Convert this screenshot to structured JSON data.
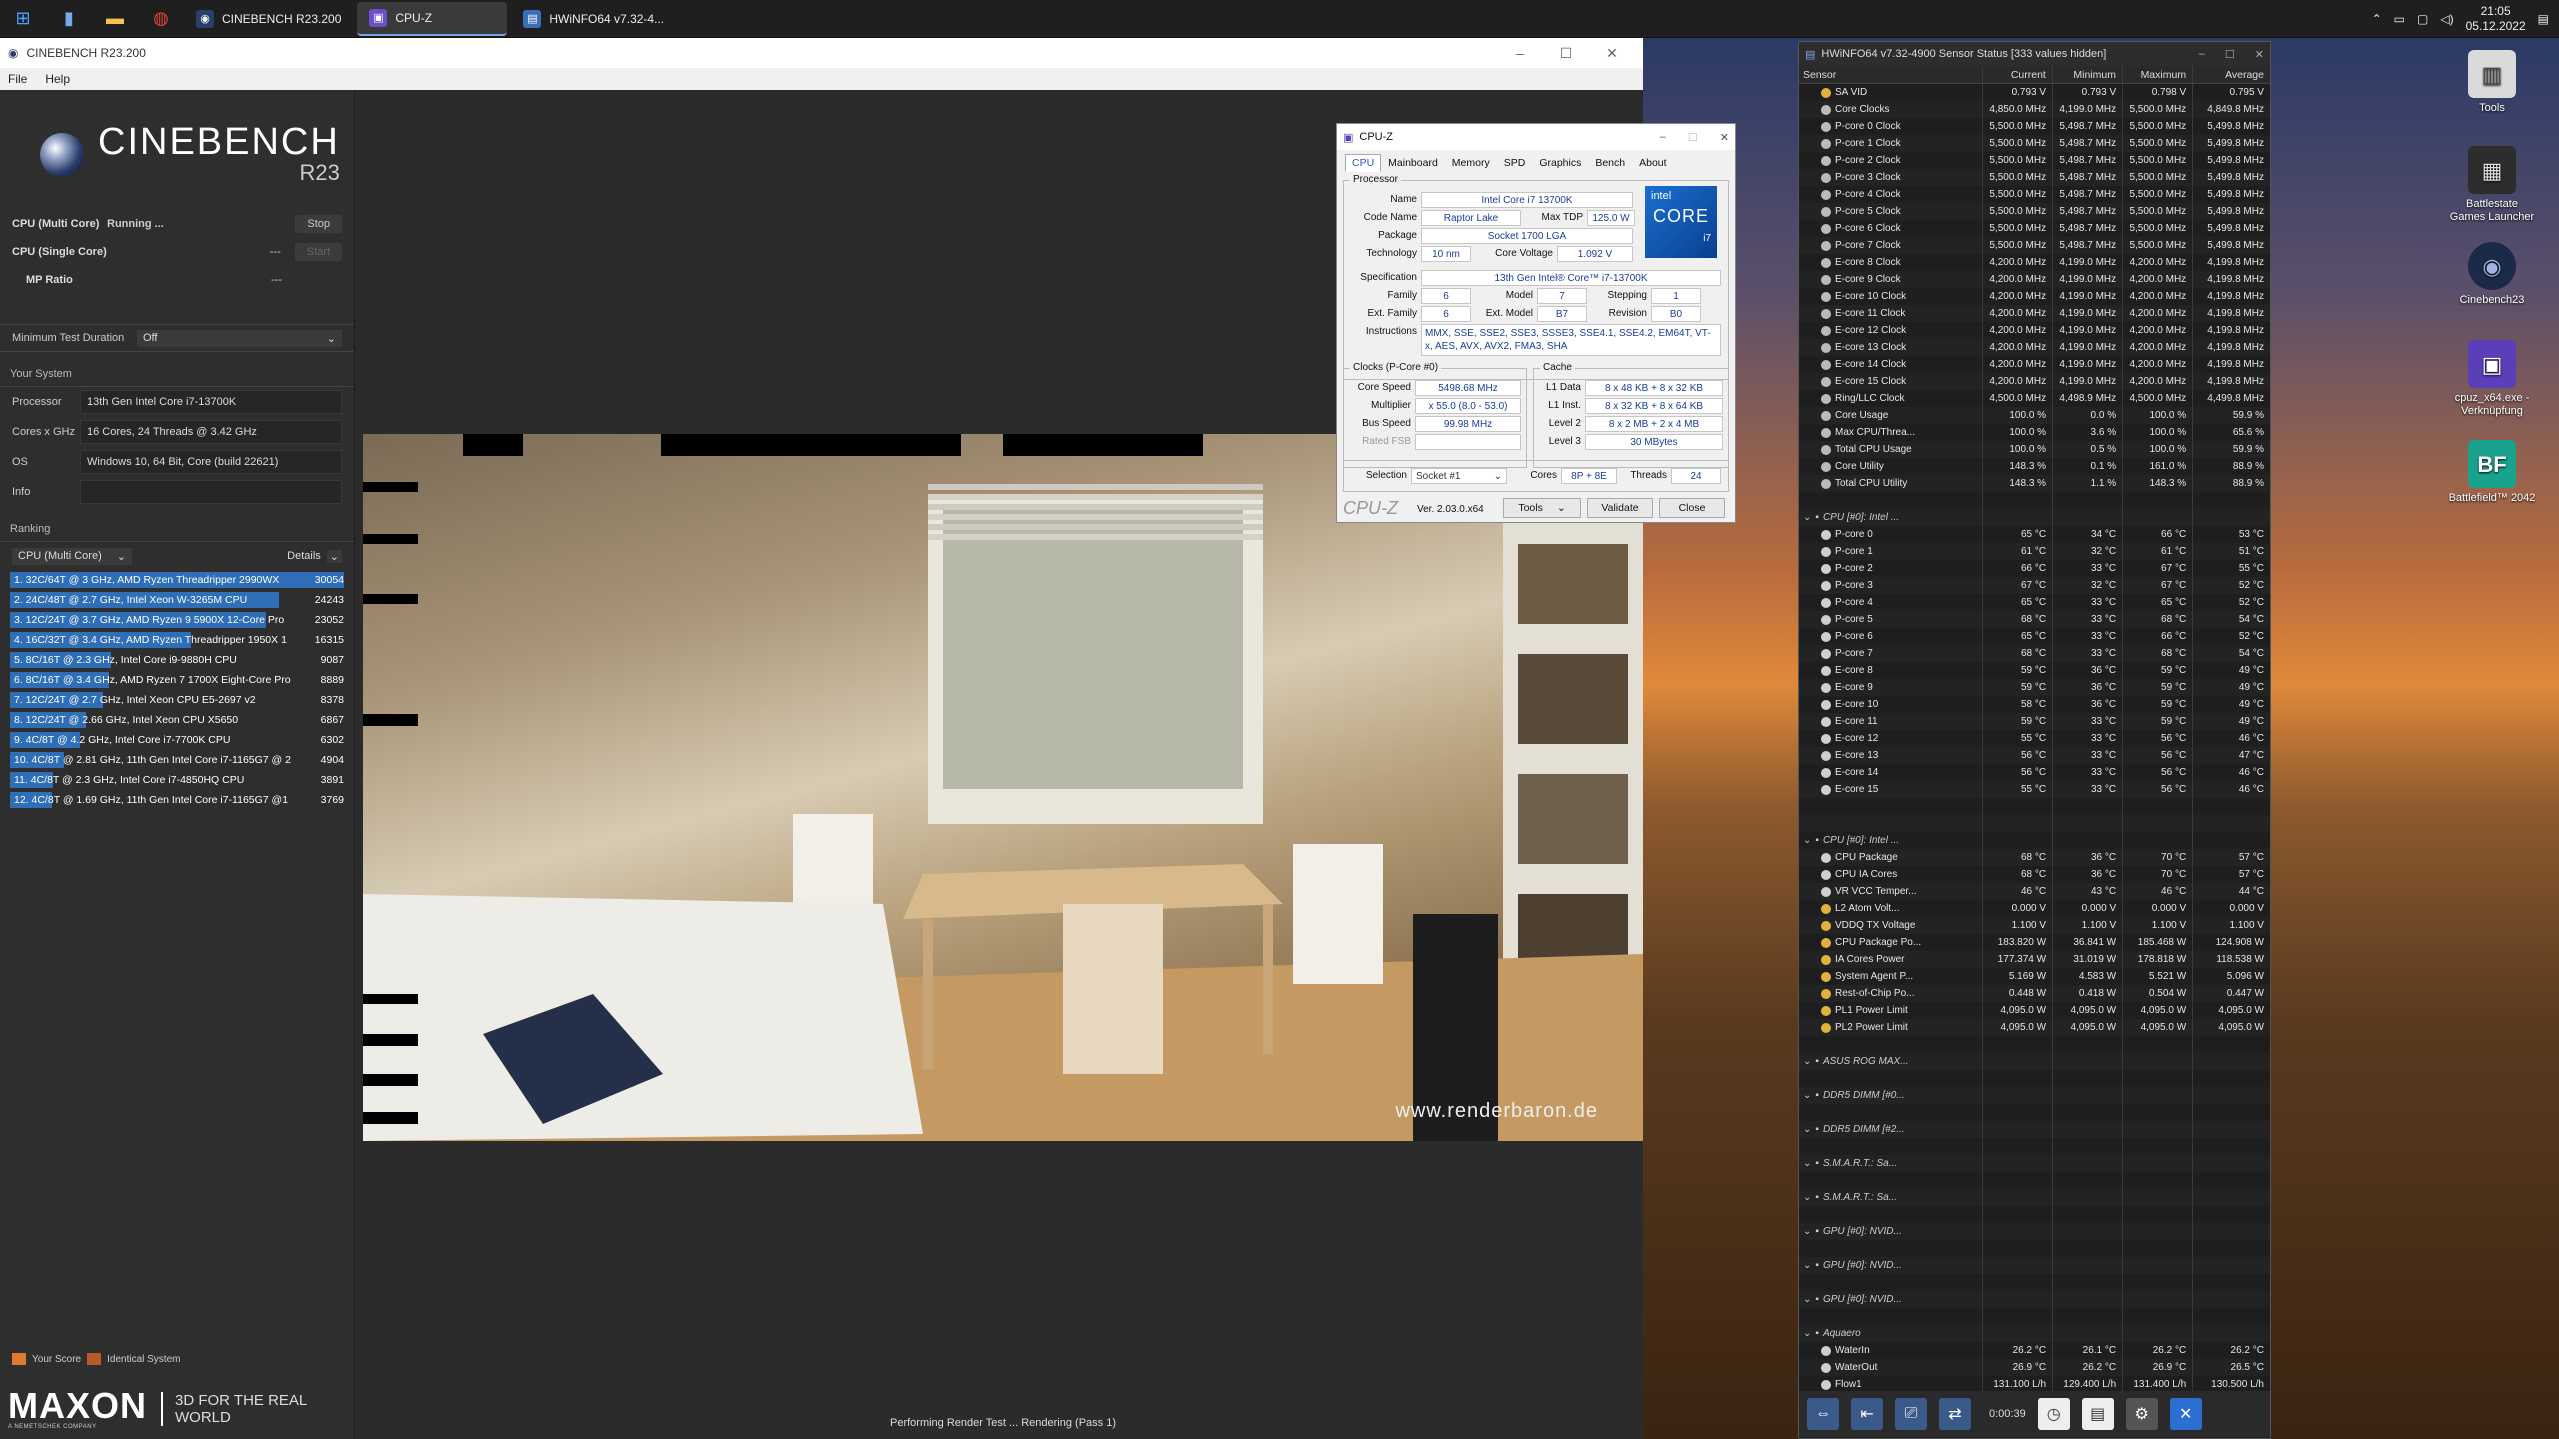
{
  "taskbar": {
    "apps": [
      {
        "label": "CINEBENCH R23.200",
        "icon": "cinebench-icon",
        "active": false
      },
      {
        "label": "CPU-Z",
        "icon": "cpuz-icon",
        "active": true
      },
      {
        "label": "HWiNFO64 v7.32-4...",
        "icon": "hwinfo-icon",
        "active": false
      }
    ],
    "time": "21:05",
    "date": "05.12.2022"
  },
  "cinebench": {
    "title": "CINEBENCH R23.200",
    "menu": [
      "File",
      "Help"
    ],
    "logo": "CINEBENCH",
    "version": "R23",
    "tests": [
      {
        "label": "CPU (Multi Core)",
        "status": "Running ...",
        "button": "Stop",
        "button_enabled": true
      },
      {
        "label": "CPU (Single Core)",
        "status": "---",
        "button": "Start",
        "button_enabled": false
      },
      {
        "label": "MP Ratio",
        "status": "---",
        "button": "",
        "button_enabled": false
      }
    ],
    "min_duration_label": "Minimum Test Duration",
    "min_duration_value": "Off",
    "your_system": "Your System",
    "system": [
      {
        "k": "Processor",
        "v": "13th Gen Intel Core i7-13700K"
      },
      {
        "k": "Cores x GHz",
        "v": "16 Cores, 24 Threads @ 3.42 GHz"
      },
      {
        "k": "OS",
        "v": "Windows 10, 64 Bit, Core (build 22621)"
      },
      {
        "k": "Info",
        "v": ""
      }
    ],
    "ranking_title": "Ranking",
    "ranking_select": "CPU (Multi Core)",
    "details": "Details",
    "ranking": [
      {
        "t": "1. 32C/64T @ 3 GHz, AMD Ryzen Threadripper 2990WX",
        "s": "30054"
      },
      {
        "t": "2. 24C/48T @ 2.7 GHz, Intel Xeon W-3265M CPU",
        "s": "24243"
      },
      {
        "t": "3. 12C/24T @ 3.7 GHz, AMD Ryzen 9 5900X 12-Core Pro",
        "s": "23052"
      },
      {
        "t": "4. 16C/32T @ 3.4 GHz, AMD Ryzen Threadripper 1950X 1",
        "s": "16315"
      },
      {
        "t": "5. 8C/16T @ 2.3 GHz, Intel Core i9-9880H CPU",
        "s": "9087"
      },
      {
        "t": "6. 8C/16T @ 3.4 GHz, AMD Ryzen 7 1700X Eight-Core Pro",
        "s": "8889"
      },
      {
        "t": "7. 12C/24T @ 2.7 GHz, Intel Xeon CPU E5-2697 v2",
        "s": "8378"
      },
      {
        "t": "8. 12C/24T @ 2.66 GHz, Intel Xeon CPU X5650",
        "s": "6867"
      },
      {
        "t": "9. 4C/8T @ 4.2 GHz, Intel Core i7-7700K CPU",
        "s": "6302"
      },
      {
        "t": "10. 4C/8T @ 2.81 GHz, 11th Gen Intel Core i7-1165G7 @ 2",
        "s": "4904"
      },
      {
        "t": "11. 4C/8T @ 2.3 GHz, Intel Core i7-4850HQ CPU",
        "s": "3891"
      },
      {
        "t": "12. 4C/8T @ 1.69 GHz, 11th Gen Intel Core i7-1165G7 @1",
        "s": "3769"
      }
    ],
    "legend_your": "Your Score",
    "legend_identical": "Identical System",
    "watermark": "www.renderbaron.de",
    "status": "Performing Render Test ... Rendering (Pass 1)",
    "maxon": "MAXON",
    "maxon_sub": "A NEMETSCHEK COMPANY",
    "slogan": "3D FOR THE REAL WORLD",
    "colors": {
      "rank_bar": "#2f6fb8",
      "your_score": "#e07a2f",
      "identical": "#b85a28"
    }
  },
  "cpuz": {
    "title": "CPU-Z",
    "tabs": [
      "CPU",
      "Mainboard",
      "Memory",
      "SPD",
      "Graphics",
      "Bench",
      "About"
    ],
    "processor_group": "Processor",
    "name_lbl": "Name",
    "name": "Intel Core i7 13700K",
    "code_lbl": "Code Name",
    "code": "Raptor Lake",
    "tdp_lbl": "Max TDP",
    "tdp": "125.0 W",
    "pkg_lbl": "Package",
    "pkg": "Socket 1700 LGA",
    "tech_lbl": "Technology",
    "tech": "10 nm",
    "volt_lbl": "Core Voltage",
    "volt": "1.092 V",
    "spec_lbl": "Specification",
    "spec": "13th Gen Intel® Core™ i7-13700K",
    "family_lbl": "Family",
    "family": "6",
    "model_lbl": "Model",
    "model": "7",
    "stepping_lbl": "Stepping",
    "stepping": "1",
    "extfam_lbl": "Ext. Family",
    "extfam": "6",
    "extmod_lbl": "Ext. Model",
    "extmod": "B7",
    "rev_lbl": "Revision",
    "rev": "B0",
    "instr_lbl": "Instructions",
    "instr": "MMX, SSE, SSE2, SSE3, SSSE3, SSE4.1, SSE4.2, EM64T, VT-x, AES, AVX, AVX2, FMA3, SHA",
    "clocks_group": "Clocks (P-Core #0)",
    "cspeed_lbl": "Core Speed",
    "cspeed": "5498.68 MHz",
    "mult_lbl": "Multiplier",
    "mult": "x 55.0 (8.0 - 53.0)",
    "bus_lbl": "Bus Speed",
    "bus": "99.98 MHz",
    "fsb_lbl": "Rated FSB",
    "cache_group": "Cache",
    "l1d_lbl": "L1 Data",
    "l1d": "8 x 48 KB + 8 x 32 KB",
    "l1i_lbl": "L1 Inst.",
    "l1i": "8 x 32 KB + 8 x 64 KB",
    "l2_lbl": "Level 2",
    "l2": "8 x 2 MB + 2 x 4 MB",
    "l3_lbl": "Level 3",
    "l3": "30 MBytes",
    "sel_lbl": "Selection",
    "sel": "Socket #1",
    "cores_lbl": "Cores",
    "cores": "8P + 8E",
    "threads_lbl": "Threads",
    "threads": "24",
    "brand": "CPU-Z",
    "ver": "Ver. 2.03.0.x64",
    "tools": "Tools",
    "validate": "Validate",
    "close": "Close",
    "badge_intel": "intel",
    "badge_core": "CORE",
    "badge_i": "i7"
  },
  "hwinfo": {
    "title": "HWiNFO64 v7.32-4900 Sensor Status [333 values hidden]",
    "cols": [
      "Sensor",
      "Current",
      "Minimum",
      "Maximum",
      "Average"
    ],
    "rows": [
      {
        "n": "SA VID",
        "c": "0.793 V",
        "mi": "0.793 V",
        "ma": "0.798 V",
        "a": "0.795 V",
        "t": "y"
      },
      {
        "n": "Core Clocks",
        "c": "4,850.0 MHz",
        "mi": "4,199.0 MHz",
        "ma": "5,500.0 MHz",
        "a": "4,849.8 MHz",
        "t": "c"
      },
      {
        "n": "P-core 0 Clock",
        "c": "5,500.0 MHz",
        "mi": "5,498.7 MHz",
        "ma": "5,500.0 MHz",
        "a": "5,499.8 MHz",
        "t": "c"
      },
      {
        "n": "P-core 1 Clock",
        "c": "5,500.0 MHz",
        "mi": "5,498.7 MHz",
        "ma": "5,500.0 MHz",
        "a": "5,499.8 MHz",
        "t": "c"
      },
      {
        "n": "P-core 2 Clock",
        "c": "5,500.0 MHz",
        "mi": "5,498.7 MHz",
        "ma": "5,500.0 MHz",
        "a": "5,499.8 MHz",
        "t": "c"
      },
      {
        "n": "P-core 3 Clock",
        "c": "5,500.0 MHz",
        "mi": "5,498.7 MHz",
        "ma": "5,500.0 MHz",
        "a": "5,499.8 MHz",
        "t": "c"
      },
      {
        "n": "P-core 4 Clock",
        "c": "5,500.0 MHz",
        "mi": "5,498.7 MHz",
        "ma": "5,500.0 MHz",
        "a": "5,499.8 MHz",
        "t": "c"
      },
      {
        "n": "P-core 5 Clock",
        "c": "5,500.0 MHz",
        "mi": "5,498.7 MHz",
        "ma": "5,500.0 MHz",
        "a": "5,499.8 MHz",
        "t": "c"
      },
      {
        "n": "P-core 6 Clock",
        "c": "5,500.0 MHz",
        "mi": "5,498.7 MHz",
        "ma": "5,500.0 MHz",
        "a": "5,499.8 MHz",
        "t": "c"
      },
      {
        "n": "P-core 7 Clock",
        "c": "5,500.0 MHz",
        "mi": "5,498.7 MHz",
        "ma": "5,500.0 MHz",
        "a": "5,499.8 MHz",
        "t": "c"
      },
      {
        "n": "E-core 8 Clock",
        "c": "4,200.0 MHz",
        "mi": "4,199.0 MHz",
        "ma": "4,200.0 MHz",
        "a": "4,199.8 MHz",
        "t": "c"
      },
      {
        "n": "E-core 9 Clock",
        "c": "4,200.0 MHz",
        "mi": "4,199.0 MHz",
        "ma": "4,200.0 MHz",
        "a": "4,199.8 MHz",
        "t": "c"
      },
      {
        "n": "E-core 10 Clock",
        "c": "4,200.0 MHz",
        "mi": "4,199.0 MHz",
        "ma": "4,200.0 MHz",
        "a": "4,199.8 MHz",
        "t": "c"
      },
      {
        "n": "E-core 11 Clock",
        "c": "4,200.0 MHz",
        "mi": "4,199.0 MHz",
        "ma": "4,200.0 MHz",
        "a": "4,199.8 MHz",
        "t": "c"
      },
      {
        "n": "E-core 12 Clock",
        "c": "4,200.0 MHz",
        "mi": "4,199.0 MHz",
        "ma": "4,200.0 MHz",
        "a": "4,199.8 MHz",
        "t": "c"
      },
      {
        "n": "E-core 13 Clock",
        "c": "4,200.0 MHz",
        "mi": "4,199.0 MHz",
        "ma": "4,200.0 MHz",
        "a": "4,199.8 MHz",
        "t": "c"
      },
      {
        "n": "E-core 14 Clock",
        "c": "4,200.0 MHz",
        "mi": "4,199.0 MHz",
        "ma": "4,200.0 MHz",
        "a": "4,199.8 MHz",
        "t": "c"
      },
      {
        "n": "E-core 15 Clock",
        "c": "4,200.0 MHz",
        "mi": "4,199.0 MHz",
        "ma": "4,200.0 MHz",
        "a": "4,199.8 MHz",
        "t": "c"
      },
      {
        "n": "Ring/LLC Clock",
        "c": "4,500.0 MHz",
        "mi": "4,498.9 MHz",
        "ma": "4,500.0 MHz",
        "a": "4,499.8 MHz",
        "t": "c"
      },
      {
        "n": "Core Usage",
        "c": "100.0 %",
        "mi": "0.0 %",
        "ma": "100.0 %",
        "a": "59.9 %",
        "t": "c"
      },
      {
        "n": "Max CPU/Threa...",
        "c": "100.0 %",
        "mi": "3.6 %",
        "ma": "100.0 %",
        "a": "65.6 %",
        "t": "c"
      },
      {
        "n": "Total CPU Usage",
        "c": "100.0 %",
        "mi": "0.5 %",
        "ma": "100.0 %",
        "a": "59.9 %",
        "t": "c"
      },
      {
        "n": "Core Utility",
        "c": "148.3 %",
        "mi": "0.1 %",
        "ma": "161.0 %",
        "a": "88.9 %",
        "t": "c"
      },
      {
        "n": "Total CPU Utility",
        "c": "148.3 %",
        "mi": "1.1 %",
        "ma": "148.3 %",
        "a": "88.9 %",
        "t": "c"
      },
      {
        "n": "",
        "c": "",
        "mi": "",
        "ma": "",
        "a": "",
        "t": "b"
      },
      {
        "n": "CPU [#0]: Intel ...",
        "c": "",
        "mi": "",
        "ma": "",
        "a": "",
        "t": "g"
      },
      {
        "n": "P-core 0",
        "c": "65 °C",
        "mi": "34 °C",
        "ma": "66 °C",
        "a": "53 °C",
        "t": "t"
      },
      {
        "n": "P-core 1",
        "c": "61 °C",
        "mi": "32 °C",
        "ma": "61 °C",
        "a": "51 °C",
        "t": "t"
      },
      {
        "n": "P-core 2",
        "c": "66 °C",
        "mi": "33 °C",
        "ma": "67 °C",
        "a": "55 °C",
        "t": "t"
      },
      {
        "n": "P-core 3",
        "c": "67 °C",
        "mi": "32 °C",
        "ma": "67 °C",
        "a": "52 °C",
        "t": "t"
      },
      {
        "n": "P-core 4",
        "c": "65 °C",
        "mi": "33 °C",
        "ma": "65 °C",
        "a": "52 °C",
        "t": "t"
      },
      {
        "n": "P-core 5",
        "c": "68 °C",
        "mi": "33 °C",
        "ma": "68 °C",
        "a": "54 °C",
        "t": "t"
      },
      {
        "n": "P-core 6",
        "c": "65 °C",
        "mi": "33 °C",
        "ma": "66 °C",
        "a": "52 °C",
        "t": "t"
      },
      {
        "n": "P-core 7",
        "c": "68 °C",
        "mi": "33 °C",
        "ma": "68 °C",
        "a": "54 °C",
        "t": "t"
      },
      {
        "n": "E-core 8",
        "c": "59 °C",
        "mi": "36 °C",
        "ma": "59 °C",
        "a": "49 °C",
        "t": "t"
      },
      {
        "n": "E-core 9",
        "c": "59 °C",
        "mi": "36 °C",
        "ma": "59 °C",
        "a": "49 °C",
        "t": "t"
      },
      {
        "n": "E-core 10",
        "c": "58 °C",
        "mi": "36 °C",
        "ma": "59 °C",
        "a": "49 °C",
        "t": "t"
      },
      {
        "n": "E-core 11",
        "c": "59 °C",
        "mi": "33 °C",
        "ma": "59 °C",
        "a": "49 °C",
        "t": "t"
      },
      {
        "n": "E-core 12",
        "c": "55 °C",
        "mi": "33 °C",
        "ma": "56 °C",
        "a": "46 °C",
        "t": "t"
      },
      {
        "n": "E-core 13",
        "c": "56 °C",
        "mi": "33 °C",
        "ma": "56 °C",
        "a": "47 °C",
        "t": "t"
      },
      {
        "n": "E-core 14",
        "c": "56 °C",
        "mi": "33 °C",
        "ma": "56 °C",
        "a": "46 °C",
        "t": "t"
      },
      {
        "n": "E-core 15",
        "c": "55 °C",
        "mi": "33 °C",
        "ma": "56 °C",
        "a": "46 °C",
        "t": "t"
      },
      {
        "n": "",
        "c": "",
        "mi": "",
        "ma": "",
        "a": "",
        "t": "b"
      },
      {
        "n": "",
        "c": "",
        "mi": "",
        "ma": "",
        "a": "",
        "t": "b"
      },
      {
        "n": "CPU [#0]: Intel ...",
        "c": "",
        "mi": "",
        "ma": "",
        "a": "",
        "t": "g"
      },
      {
        "n": "CPU Package",
        "c": "68 °C",
        "mi": "36 °C",
        "ma": "70 °C",
        "a": "57 °C",
        "t": "t"
      },
      {
        "n": "CPU IA Cores",
        "c": "68 °C",
        "mi": "36 °C",
        "ma": "70 °C",
        "a": "57 °C",
        "t": "t"
      },
      {
        "n": "VR VCC Temper...",
        "c": "46 °C",
        "mi": "43 °C",
        "ma": "46 °C",
        "a": "44 °C",
        "t": "t"
      },
      {
        "n": "L2 Atom Volt...",
        "c": "0.000 V",
        "mi": "0.000 V",
        "ma": "0.000 V",
        "a": "0.000 V",
        "t": "y"
      },
      {
        "n": "VDDQ TX Voltage",
        "c": "1.100 V",
        "mi": "1.100 V",
        "ma": "1.100 V",
        "a": "1.100 V",
        "t": "y"
      },
      {
        "n": "CPU Package Po...",
        "c": "183.820 W",
        "mi": "36.841 W",
        "ma": "185.468 W",
        "a": "124.908 W",
        "t": "y"
      },
      {
        "n": "IA Cores Power",
        "c": "177.374 W",
        "mi": "31.019 W",
        "ma": "178.818 W",
        "a": "118.538 W",
        "t": "y"
      },
      {
        "n": "System Agent P...",
        "c": "5.169 W",
        "mi": "4.583 W",
        "ma": "5.521 W",
        "a": "5.096 W",
        "t": "y"
      },
      {
        "n": "Rest-of-Chip Po...",
        "c": "0.448 W",
        "mi": "0.418 W",
        "ma": "0.504 W",
        "a": "0.447 W",
        "t": "y"
      },
      {
        "n": "PL1 Power Limit",
        "c": "4,095.0 W",
        "mi": "4,095.0 W",
        "ma": "4,095.0 W",
        "a": "4,095.0 W",
        "t": "y"
      },
      {
        "n": "PL2 Power Limit",
        "c": "4,095.0 W",
        "mi": "4,095.0 W",
        "ma": "4,095.0 W",
        "a": "4,095.0 W",
        "t": "y"
      },
      {
        "n": "",
        "c": "",
        "mi": "",
        "ma": "",
        "a": "",
        "t": "b"
      },
      {
        "n": "ASUS ROG MAX...",
        "c": "",
        "mi": "",
        "ma": "",
        "a": "",
        "t": "g"
      },
      {
        "n": "",
        "c": "",
        "mi": "",
        "ma": "",
        "a": "",
        "t": "b"
      },
      {
        "n": "DDR5 DIMM [#0...",
        "c": "",
        "mi": "",
        "ma": "",
        "a": "",
        "t": "g"
      },
      {
        "n": "",
        "c": "",
        "mi": "",
        "ma": "",
        "a": "",
        "t": "b"
      },
      {
        "n": "DDR5 DIMM [#2...",
        "c": "",
        "mi": "",
        "ma": "",
        "a": "",
        "t": "g"
      },
      {
        "n": "",
        "c": "",
        "mi": "",
        "ma": "",
        "a": "",
        "t": "b"
      },
      {
        "n": "S.M.A.R.T.: Sa...",
        "c": "",
        "mi": "",
        "ma": "",
        "a": "",
        "t": "g"
      },
      {
        "n": "",
        "c": "",
        "mi": "",
        "ma": "",
        "a": "",
        "t": "b"
      },
      {
        "n": "S.M.A.R.T.: Sa...",
        "c": "",
        "mi": "",
        "ma": "",
        "a": "",
        "t": "g"
      },
      {
        "n": "",
        "c": "",
        "mi": "",
        "ma": "",
        "a": "",
        "t": "b"
      },
      {
        "n": "GPU [#0]: NVID...",
        "c": "",
        "mi": "",
        "ma": "",
        "a": "",
        "t": "g"
      },
      {
        "n": "",
        "c": "",
        "mi": "",
        "ma": "",
        "a": "",
        "t": "b"
      },
      {
        "n": "GPU [#0]: NVID...",
        "c": "",
        "mi": "",
        "ma": "",
        "a": "",
        "t": "g"
      },
      {
        "n": "",
        "c": "",
        "mi": "",
        "ma": "",
        "a": "",
        "t": "b"
      },
      {
        "n": "GPU [#0]: NVID...",
        "c": "",
        "mi": "",
        "ma": "",
        "a": "",
        "t": "g"
      },
      {
        "n": "",
        "c": "",
        "mi": "",
        "ma": "",
        "a": "",
        "t": "b"
      },
      {
        "n": "Aquaero",
        "c": "",
        "mi": "",
        "ma": "",
        "a": "",
        "t": "g"
      },
      {
        "n": "WaterIn",
        "c": "26.2 °C",
        "mi": "26.1 °C",
        "ma": "26.2 °C",
        "a": "26.2 °C",
        "t": "t"
      },
      {
        "n": "WaterOut",
        "c": "26.9 °C",
        "mi": "26.2 °C",
        "ma": "26.9 °C",
        "a": "26.5 °C",
        "t": "t"
      },
      {
        "n": "Flow1",
        "c": "131.100 L/h",
        "mi": "129.400 L/h",
        "ma": "131.400 L/h",
        "a": "130.500 L/h",
        "t": "t"
      }
    ],
    "timer": "0:00:39",
    "colors": {
      "clock": "#bbbbbb",
      "temp": "#cfcfcf",
      "volt": "#e3b23c"
    }
  },
  "desktop": [
    {
      "label": "Tools",
      "glyph": "▥"
    },
    {
      "label": "Battlestate Games Launcher",
      "glyph": "▦"
    },
    {
      "label": "Cinebench23",
      "glyph": "◉"
    },
    {
      "label": "cpuz_x64.exe - Verknüpfung",
      "glyph": "▣"
    },
    {
      "label": "Battlefield™ 2042",
      "glyph": "BF"
    }
  ]
}
